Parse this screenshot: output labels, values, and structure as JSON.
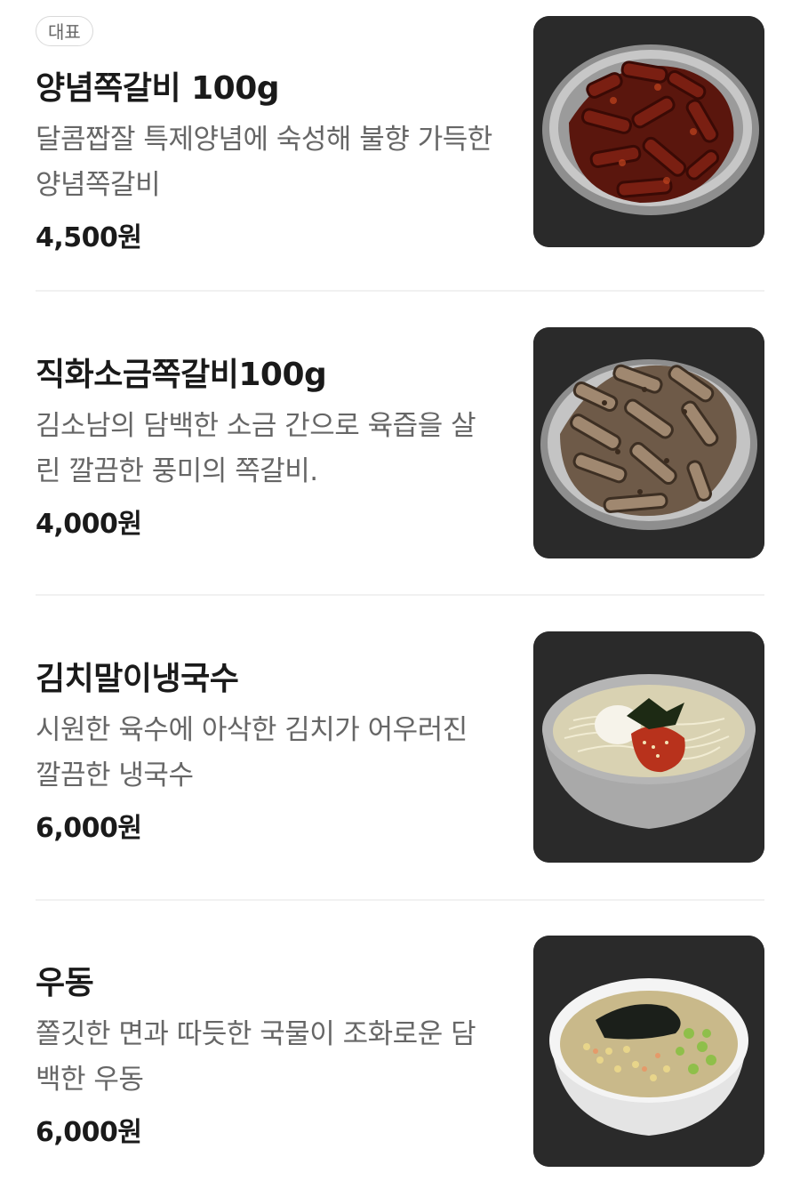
{
  "menu": {
    "items": [
      {
        "badge": "대표",
        "name": "양념쪽갈비 100g",
        "description": "달콤짭잘 특제양념에 숙성해 불향 가득한 양념쪽갈비",
        "price": "4,500원",
        "image_icon": "marinated-ribs-photo"
      },
      {
        "name": "직화소금쪽갈비100g",
        "description": "김소남의 담백한 소금 간으로 육즙을 살린 깔끔한 풍미의 쪽갈비.",
        "price": "4,000원",
        "image_icon": "salt-grilled-ribs-photo"
      },
      {
        "name": "김치말이냉국수",
        "description": "시원한 육수에 아삭한 김치가 어우러진 깔끔한 냉국수",
        "price": "6,000원",
        "image_icon": "kimchi-cold-noodle-photo"
      },
      {
        "name": "우동",
        "description": "쫄깃한 면과 따듯한 국물이 조화로운 담백한 우동",
        "price": "6,000원",
        "image_icon": "udon-photo"
      }
    ]
  },
  "colors": {
    "background": "#ffffff",
    "title": "#1a1a1a",
    "description": "#666666",
    "divider": "#f1f1f1",
    "photo_background": "#2b2b2b"
  }
}
